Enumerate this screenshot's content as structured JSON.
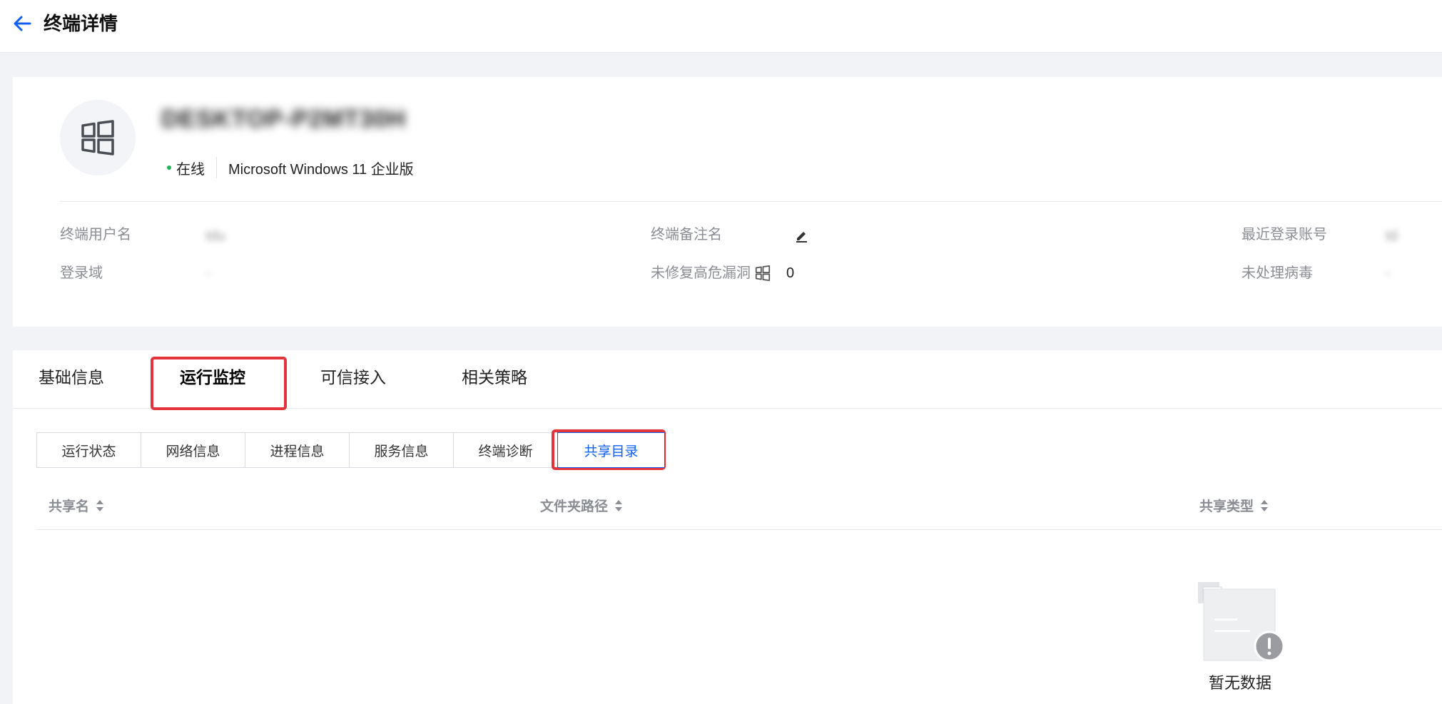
{
  "header": {
    "title": "终端详情"
  },
  "device": {
    "name": "DESKTOP-P2MT30H",
    "status": "在线",
    "os": "Microsoft Windows 11 企业版"
  },
  "info": {
    "terminal_user_label": "终端用户名",
    "terminal_user_value": "tdu",
    "login_domain_label": "登录域",
    "login_domain_value": "-",
    "remark_label": "终端备注名",
    "vuln_label": "未修复高危漏洞",
    "vuln_value": "0",
    "recent_account_label": "最近登录账号",
    "recent_account_value": "td",
    "virus_label": "未处理病毒",
    "virus_value": "-"
  },
  "main_tabs": [
    {
      "label": "基础信息"
    },
    {
      "label": "运行监控"
    },
    {
      "label": "可信接入"
    },
    {
      "label": "相关策略"
    }
  ],
  "sub_tabs": [
    {
      "label": "运行状态"
    },
    {
      "label": "网络信息"
    },
    {
      "label": "进程信息"
    },
    {
      "label": "服务信息"
    },
    {
      "label": "终端诊断"
    },
    {
      "label": "共享目录"
    }
  ],
  "table": {
    "columns": [
      {
        "label": "共享名"
      },
      {
        "label": "文件夹路径"
      },
      {
        "label": "共享类型"
      }
    ],
    "empty_text": "暂无数据"
  },
  "colors": {
    "accent": "#0f5ff5",
    "highlight": "#e3343b",
    "online": "#20b25b"
  }
}
